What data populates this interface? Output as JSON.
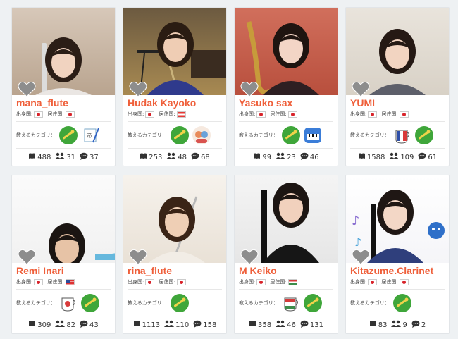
{
  "labels": {
    "origin": "出身国:",
    "residence": "居住国:",
    "category": "教えるカテゴリ："
  },
  "colors": {
    "name": "#ef5f3a",
    "heart": "#8d8d8d",
    "flute_badge": "#3fa63a"
  },
  "teachers": [
    {
      "name": "mana_flute",
      "origin_flag": "jp",
      "residence_flag": "jp",
      "categories": [
        "flute-badge-icon",
        "japanese-writing-icon"
      ],
      "stats": {
        "lessons": "488",
        "students": "31",
        "reviews": "37"
      }
    },
    {
      "name": "Hudak Kayoko",
      "origin_flag": "jp",
      "residence_flag": "at",
      "categories": [
        "flute-badge-icon",
        "kids-icon"
      ],
      "stats": {
        "lessons": "253",
        "students": "48",
        "reviews": "68"
      }
    },
    {
      "name": "Yasuko sax",
      "origin_flag": "jp",
      "residence_flag": "jp",
      "categories": [
        "flute-badge-icon",
        "keyboard-music-icon"
      ],
      "stats": {
        "lessons": "99",
        "students": "23",
        "reviews": "46"
      }
    },
    {
      "name": "YUMI",
      "origin_flag": "jp",
      "residence_flag": "jp",
      "categories": [
        "french-cup-icon",
        "flute-badge-icon"
      ],
      "stats": {
        "lessons": "1588",
        "students": "109",
        "reviews": "61"
      }
    },
    {
      "name": "Remi Inari",
      "origin_flag": "jp",
      "residence_flag": "us",
      "categories": [
        "japanese-cup-icon",
        "flute-badge-icon"
      ],
      "stats": {
        "lessons": "309",
        "students": "82",
        "reviews": "43"
      }
    },
    {
      "name": "rina_flute",
      "origin_flag": "jp",
      "residence_flag": "jp",
      "categories": [
        "flute-badge-icon"
      ],
      "stats": {
        "lessons": "1113",
        "students": "110",
        "reviews": "158"
      }
    },
    {
      "name": "M Keiko",
      "origin_flag": "jp",
      "residence_flag": "hu",
      "categories": [
        "hungarian-cup-icon",
        "flute-badge-icon"
      ],
      "stats": {
        "lessons": "358",
        "students": "46",
        "reviews": "131"
      }
    },
    {
      "name": "Kitazume.Clarinet",
      "origin_flag": "jp",
      "residence_flag": "jp",
      "categories": [
        "flute-badge-icon"
      ],
      "stats": {
        "lessons": "83",
        "students": "9",
        "reviews": "2"
      }
    }
  ]
}
